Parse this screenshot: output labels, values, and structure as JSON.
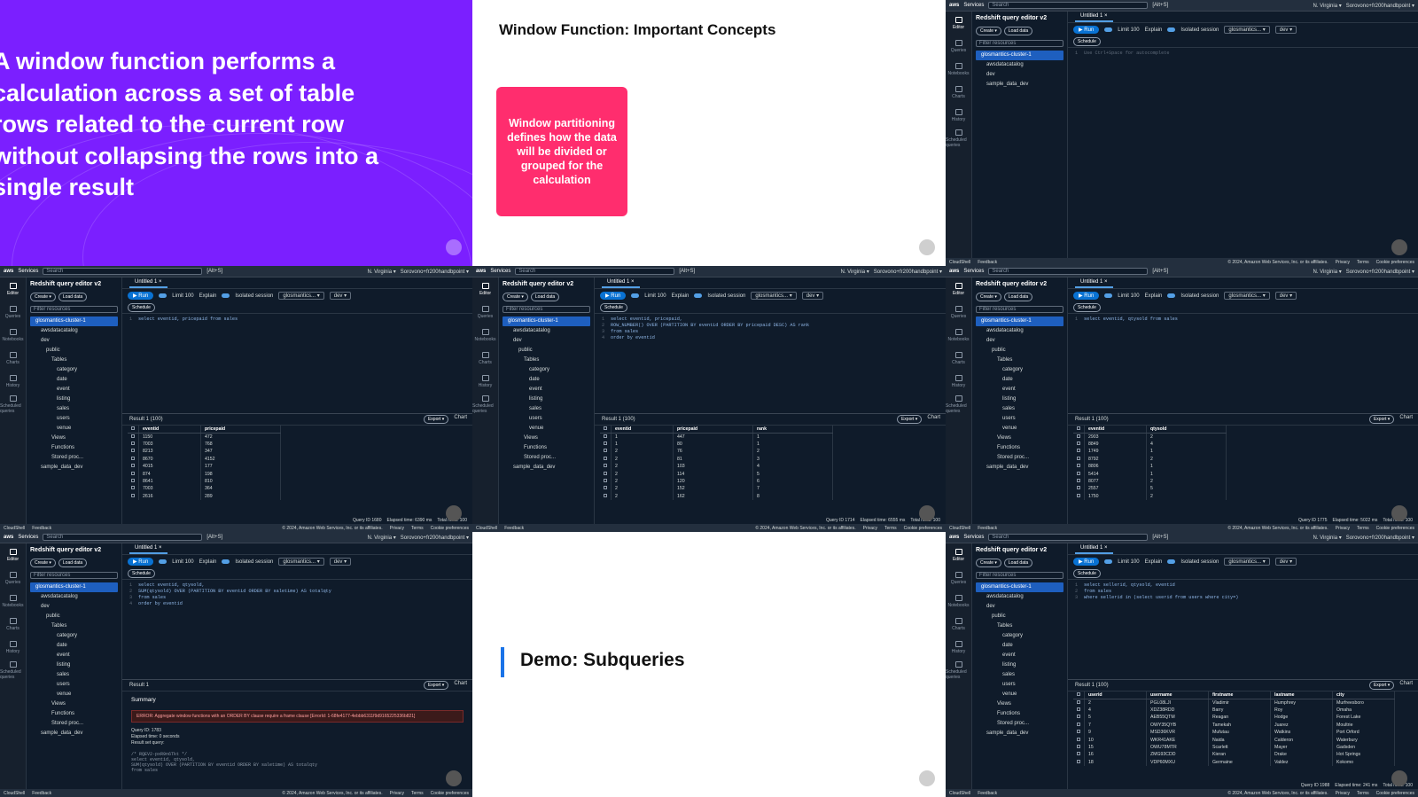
{
  "slide1": {
    "text": "A window function performs a calculation across a set of table rows related to the current row without collapsing the rows into a single result"
  },
  "slide2": {
    "title": "Window Function: Important Concepts",
    "card": "Window partitioning defines how the data will be divided or grouped for the calculation"
  },
  "slide8": {
    "title": "Demo: Subqueries"
  },
  "console": {
    "logo": "aws",
    "services": "Services",
    "search_placeholder": "Search",
    "search_shortcut": "[Alt+S]",
    "region": "N. Virginia ▾",
    "account": "Sorovono+fr200handbpoint ▾",
    "app_title": "Redshift query editor v2",
    "create": "Create ▾",
    "load": "Load data",
    "filter_placeholder": "Filter resources",
    "tab": "Untitled 1 ×",
    "run": "▶ Run",
    "limit": "Limit 100",
    "explain": "Explain",
    "isolated": "Isolated session",
    "cluster_sel": "glosmantics... ▾",
    "db_sel": "dev ▾",
    "schedule": "Schedule",
    "export": "Export ▾",
    "chart": "Chart",
    "rail": [
      "Editor",
      "Queries",
      "Notebooks",
      "Charts",
      "History",
      "Scheduled queries"
    ],
    "tree": [
      "glosmantics-cluster-1",
      "awsdatacatalog",
      "dev",
      "public",
      "Tables",
      "category",
      "date",
      "event",
      "listing",
      "sales",
      "users",
      "venue",
      "Views",
      "Functions",
      "Stored proc...",
      "sample_data_dev"
    ],
    "footer_left": [
      "CloudShell",
      "Feedback"
    ],
    "footer_right": [
      "© 2024, Amazon Web Services, Inc. or its affiliates.",
      "Privacy",
      "Terms",
      "Cookie preferences"
    ]
  },
  "pane3": {
    "editor_hint": "Use Ctrl+Space for autocomplete"
  },
  "pane4": {
    "code": [
      "select eventid, pricepaid from sales"
    ],
    "result_label": "Result 1 (100)",
    "columns": [
      "eventid",
      "pricepaid"
    ],
    "rows": [
      [
        "1150",
        "472"
      ],
      [
        "7003",
        "768"
      ],
      [
        "8213",
        "347"
      ],
      [
        "8670",
        "4152"
      ],
      [
        "4015",
        "177"
      ],
      [
        "874",
        "198"
      ],
      [
        "8641",
        "810"
      ],
      [
        "7003",
        "364"
      ],
      [
        "2616",
        "289"
      ]
    ],
    "footer": [
      "Query ID 1680",
      "Elapsed time: 6390 ms",
      "Total rows: 100"
    ]
  },
  "pane5": {
    "code": [
      "select eventid, pricepaid,",
      "ROW_NUMBER() OVER (PARTITION BY eventid ORDER BY pricepaid DESC) AS rank",
      "from sales",
      "order by eventid"
    ],
    "result_label": "Result 1 (100)",
    "columns": [
      "eventid",
      "pricepaid",
      "rank"
    ],
    "rows": [
      [
        "1",
        "447",
        "1"
      ],
      [
        "1",
        "80",
        "1"
      ],
      [
        "2",
        "76",
        "2"
      ],
      [
        "2",
        "81",
        "3"
      ],
      [
        "2",
        "103",
        "4"
      ],
      [
        "2",
        "114",
        "5"
      ],
      [
        "2",
        "120",
        "6"
      ],
      [
        "2",
        "152",
        "7"
      ],
      [
        "2",
        "162",
        "8"
      ]
    ],
    "footer": [
      "Query ID 1714",
      "Elapsed time: 6555 ms",
      "Total rows: 100"
    ]
  },
  "pane6": {
    "code": [
      "select eventid, qtysold from sales"
    ],
    "result_label": "Result 1 (100)",
    "columns": [
      "eventid",
      "qtysold"
    ],
    "rows": [
      [
        "2903",
        "2"
      ],
      [
        "8849",
        "4"
      ],
      [
        "1749",
        "1"
      ],
      [
        "8792",
        "2"
      ],
      [
        "8806",
        "1"
      ],
      [
        "5414",
        "1"
      ],
      [
        "8077",
        "2"
      ],
      [
        "2557",
        "5"
      ],
      [
        "1750",
        "2"
      ]
    ],
    "footer": [
      "Query ID 1775",
      "Elapsed time: 5022 ms",
      "Total rows: 100"
    ]
  },
  "pane7": {
    "code": [
      "select eventid, qtysold,",
      "SUM(qtysold) OVER (PARTITION BY eventid ORDER BY saletime) AS totalqty",
      "from sales",
      "order by eventid"
    ],
    "result_label": "Result 1",
    "summary": "Summary",
    "error": "ERROR: Aggregate window functions with an ORDER BY clause require a frame clause [ErrorId: 1-68fe4177-4ebbb6311f9d9165225336b821]",
    "meta": [
      "Query ID: 1783",
      "Elapsed time: 0 seconds",
      "Result set query:"
    ],
    "query_echo": [
      "/* RQEV2-pxR9n6Tkt */",
      "select eventid, qtysold,",
      "SUM(qtysold) OVER (PARTITION BY eventid ORDER BY saletime) AS totalqty",
      "from sales"
    ]
  },
  "pane9": {
    "code": [
      "select sellerid, qtysold, eventid",
      "from sales",
      "where sellerid in (select userid from users where city=)"
    ],
    "result_label": "Result 1 (100)",
    "columns": [
      "userid",
      "username",
      "firstname",
      "lastname",
      "city"
    ],
    "rows": [
      [
        "2",
        "PGL08LJI",
        "Vladimir",
        "Humphrey",
        "Murfreesboro"
      ],
      [
        "4",
        "XDZ38RDD",
        "Barry",
        "Roy",
        "Omaha"
      ],
      [
        "5",
        "AEB55QTM",
        "Reagan",
        "Hodge",
        "Forest Lake"
      ],
      [
        "7",
        "OWY35QYB",
        "Tamekah",
        "Juarez",
        "Moultrie"
      ],
      [
        "9",
        "MSD36KVR",
        "Mufutau",
        "Watkins",
        "Port Orford"
      ],
      [
        "10",
        "WKR41AKE",
        "Naida",
        "Calderon",
        "Waterbury"
      ],
      [
        "15",
        "OWU78MTR",
        "Scarlett",
        "Mayer",
        "Gadsden"
      ],
      [
        "16",
        "ZMG93CDD",
        "Kieran",
        "Drake",
        "Hot Springs"
      ],
      [
        "18",
        "VDP60MXU",
        "Germaine",
        "Valdez",
        "Kokomo"
      ]
    ],
    "footer": [
      "Query ID 1988",
      "Elapsed time: 241 ms",
      "Total rows: 100"
    ]
  }
}
